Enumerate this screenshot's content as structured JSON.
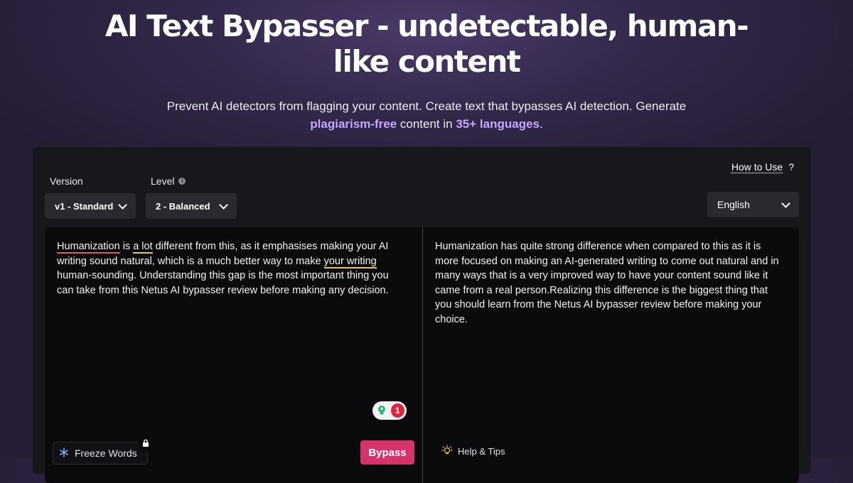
{
  "hero": {
    "title_line1": "AI Text Bypasser - undetectable, human-",
    "title_line2": "like content",
    "subtitle_line1": "Prevent AI detectors from flagging your content. Create text that bypasses AI detection. Generate",
    "subtitle_hl1": "plagiarism-free",
    "subtitle_mid": " content in ",
    "subtitle_hl2": "35+ languages",
    "subtitle_end": "."
  },
  "toolbar": {
    "how_to_use": "How to Use",
    "how_to_icon": "?",
    "version_label": "Version",
    "version_value": "v1 - Standard",
    "level_label": "Level",
    "level_info_icon": "i",
    "level_value": "2 - Balanced",
    "language_value": "English"
  },
  "input": {
    "w1": "Humanization",
    "t1": " is ",
    "w2": "a lot",
    "t2": " different from this, as it emphasises making your AI writing sound natural, which is a much better way to make ",
    "w3": "your writing",
    "t3": " human-sounding. Understanding this gap is the most important thing you can take from this Netus AI bypasser review before making any decision."
  },
  "output": {
    "text": "Humanization has quite strong difference when compared to this as it is more focused on making an AI-generated writing to come out natural and in many ways that is a very improved way to have your content sound like it came from a real person.Realizing this difference is the biggest thing that you should learn from the Netus AI bypasser review before making your choice."
  },
  "badge": {
    "count": "1",
    "icon": "lightbulb-icon",
    "count_color": "#d9263f"
  },
  "actions": {
    "freeze_words": "Freeze Words",
    "bypass": "Bypass",
    "help_tips": "Help & Tips"
  },
  "colors": {
    "accent": "#c7a6ff",
    "bypass": "#d6336c"
  }
}
